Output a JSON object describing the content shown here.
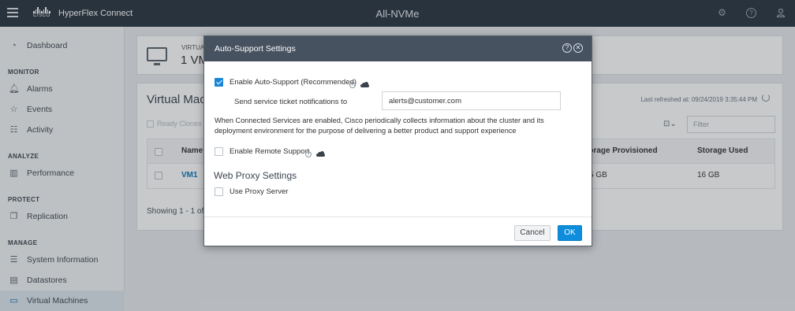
{
  "header": {
    "app_name": "HyperFlex Connect",
    "cisco_word": "CISCO",
    "cluster_name": "All-NVMe"
  },
  "sidebar": {
    "sections": {
      "monitor": "MONITOR",
      "analyze": "ANALYZE",
      "protect": "PROTECT",
      "manage": "MANAGE"
    },
    "items": [
      {
        "label": "Dashboard",
        "icon": "dashboard-icon"
      },
      {
        "label": "Alarms",
        "icon": "bell-icon"
      },
      {
        "label": "Events",
        "icon": "star-icon"
      },
      {
        "label": "Activity",
        "icon": "activity-icon"
      },
      {
        "label": "Performance",
        "icon": "bar-chart-icon"
      },
      {
        "label": "Replication",
        "icon": "replication-icon"
      },
      {
        "label": "System Information",
        "icon": "system-info-icon"
      },
      {
        "label": "Datastores",
        "icon": "datastore-icon"
      },
      {
        "label": "Virtual Machines",
        "icon": "monitor-icon"
      }
    ]
  },
  "summary": {
    "label": "VIRTUAL",
    "count": "1 VM"
  },
  "vm_panel": {
    "title": "Virtual Mach",
    "last_refreshed": "Last refreshed at: 09/24/2019 3:35:44 PM",
    "ready_clones": "Ready Clones",
    "filter_placeholder": "Filter",
    "columns": {
      "name": "Name",
      "storage_provisioned": "torage Provisioned",
      "storage_used": "Storage Used"
    },
    "rows": [
      {
        "name": "VM1",
        "storage_provisioned": "5 GB",
        "storage_used": "16 GB"
      }
    ],
    "showing": "Showing 1 - 1 of 1"
  },
  "modal": {
    "title": "Auto-Support Settings",
    "enable_auto_support": "Enable Auto-Support (Recommended)",
    "enable_auto_support_checked": true,
    "send_label": "Send service ticket notifications to",
    "email_value": "alerts@customer.com",
    "description": "When Connected Services are enabled, Cisco periodically collects information about the cluster and its deployment environment for the purpose of delivering a better product and support experience",
    "enable_remote_support": "Enable Remote Support",
    "enable_remote_support_checked": false,
    "web_proxy_heading": "Web Proxy Settings",
    "use_proxy_server": "Use Proxy Server",
    "use_proxy_server_checked": false,
    "cancel_label": "Cancel",
    "ok_label": "OK"
  },
  "colors": {
    "topbar": "#2b3540",
    "modal_header": "#475260",
    "accent": "#1786d6",
    "link": "#0d74b8"
  }
}
